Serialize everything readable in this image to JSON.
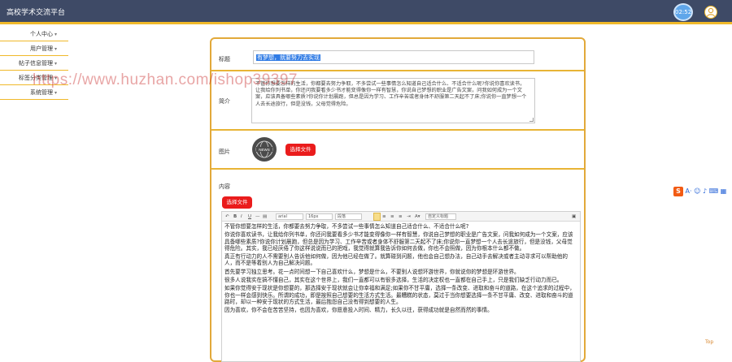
{
  "app": {
    "title": "高校学术交流平台",
    "clock": "02:52"
  },
  "sidebar": {
    "items": [
      {
        "label": "个人中心"
      },
      {
        "label": "用户管理"
      },
      {
        "label": "帖子信息管理"
      },
      {
        "label": "标签分类管理"
      },
      {
        "label": "系统管理"
      }
    ]
  },
  "form": {
    "title_label": "标题",
    "title_value": "有梦想，就要努力去实现",
    "intro_label": "简介",
    "intro_value": "不管你想要怎样的生活，你都要去努力争取，不多尝试一些事情怎么知道自己适合什么、不适合什么呢?你说你喜欢读书，让我给你列书单，你还问我要看多少书才能变得像你一样有智慧，你说自己梦想的职业是广告文案，问我如何成为一个文案，应该具备哪些素质?你说你计划晨跑，但总是因为学习、工作辛苦或者身体不舒服第二天起不了床;你说你一直梦想一个人去长途旅行，但是没钱，父母觉得危险。",
    "image_label": "图片",
    "image_text": "NEWS",
    "choose_file": "选择文件",
    "content_label": "内容",
    "content_choose_file": "选择文件"
  },
  "editor": {
    "font": "arial",
    "size": "16px",
    "paragraph": "段落",
    "custom_title": "自定义标题",
    "paragraphs": [
      "不管你想要怎样的生活，你都要去努力争取，不多尝试一些事情怎么知道自己适合什么、不适合什么呢?",
      "你说你喜欢读书，让我给你列书单，你还问我要看多少书才能变得像你一样有智慧，你说自己梦想的职业是广告文案，问我如何成为一个文案，应该具备哪些素质?你说你计划晨跑，但总是因为学习、工作辛苦或者身体不舒服第二天起不了床;你说你一直梦想一个人去长途旅行，但是没钱，父母觉得危险。其实，我已经厌倦了你这样说说而已的把戏，我觉得就算我告诉你如何去做，你也不会照做，因为你根本什么都不做。",
      "真正有行动力的人不需要别人告诉他如何做，因为他已经在做了。就算碰到问题，他也会自己想办法，自己动手去解决或者主动寻求可以帮助他的人，而不是等着别人为自己解决问题。",
      "首先要学习独立思考。花一点时间想一下自己喜欢什么，梦想是什么，不要别人说想环游世界，你就说你的梦想是环游世界。",
      "很多人说我实在搞不懂自己，其实在这个世界上，我们一直都可以有很多选择，生活的决定权也一直都在自己手上，只是我们缺乏行动力而已。",
      "如果你觉得安于现状是你想要的，那选择安于现状就会让你幸福和满足;如果你不甘平庸，选择一条改变、进取和奋斗的道路，在这个追求的过程中，你也一样会感到快乐。所谓的成功，即是按照自己想要的生活方式生活。最糟糕的状态，莫过于当你想要选择一条不甘平庸、改变、进取和奋斗的道路时，却以一种安于现状的方式生活，最后抱怨自己没有得到想要的人生。",
      "因为喜欢，你不会在苦苦坚持，也因为喜欢，你愿意投入时间、精力，长久以往，获得成功就是自然而然的事情。"
    ]
  },
  "watermark": "https://www.huzhan.com/ishop39397",
  "ime": {
    "letter": "S",
    "label": "A·"
  },
  "footer": {
    "top_link": "Top"
  },
  "colors": {
    "topbar": "#3e4a66",
    "accent": "#f0b92a",
    "button": "#ea1c1c",
    "selection": "#2f7be5"
  }
}
